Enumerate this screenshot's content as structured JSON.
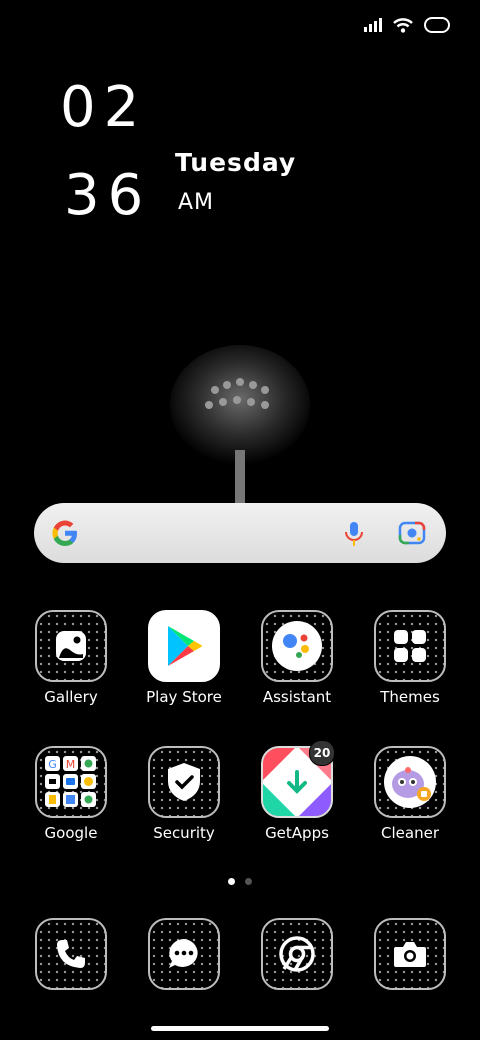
{
  "status_bar": {
    "icons": [
      "signal-icon",
      "wifi-icon",
      "battery-icon"
    ]
  },
  "clock": {
    "hour": "02",
    "minute": "36",
    "day": "Tuesday",
    "ampm": "AM"
  },
  "search": {
    "icons": [
      "google-g-icon",
      "microphone-icon",
      "google-lens-icon"
    ]
  },
  "apps_row1": [
    {
      "label": "Gallery",
      "icon": "gallery-icon"
    },
    {
      "label": "Play Store",
      "icon": "play-store-icon"
    },
    {
      "label": "Assistant",
      "icon": "assistant-icon"
    },
    {
      "label": "Themes",
      "icon": "themes-icon"
    }
  ],
  "apps_row2": [
    {
      "label": "Google",
      "icon": "google-folder-icon"
    },
    {
      "label": "Security",
      "icon": "security-icon"
    },
    {
      "label": "GetApps",
      "icon": "getapps-icon",
      "badge": "20"
    },
    {
      "label": "Cleaner",
      "icon": "cleaner-icon"
    }
  ],
  "dock": [
    {
      "icon": "phone-icon"
    },
    {
      "icon": "messages-icon"
    },
    {
      "icon": "chrome-icon"
    },
    {
      "icon": "camera-icon"
    }
  ],
  "page_indicator": {
    "current": 1,
    "total": 2
  }
}
